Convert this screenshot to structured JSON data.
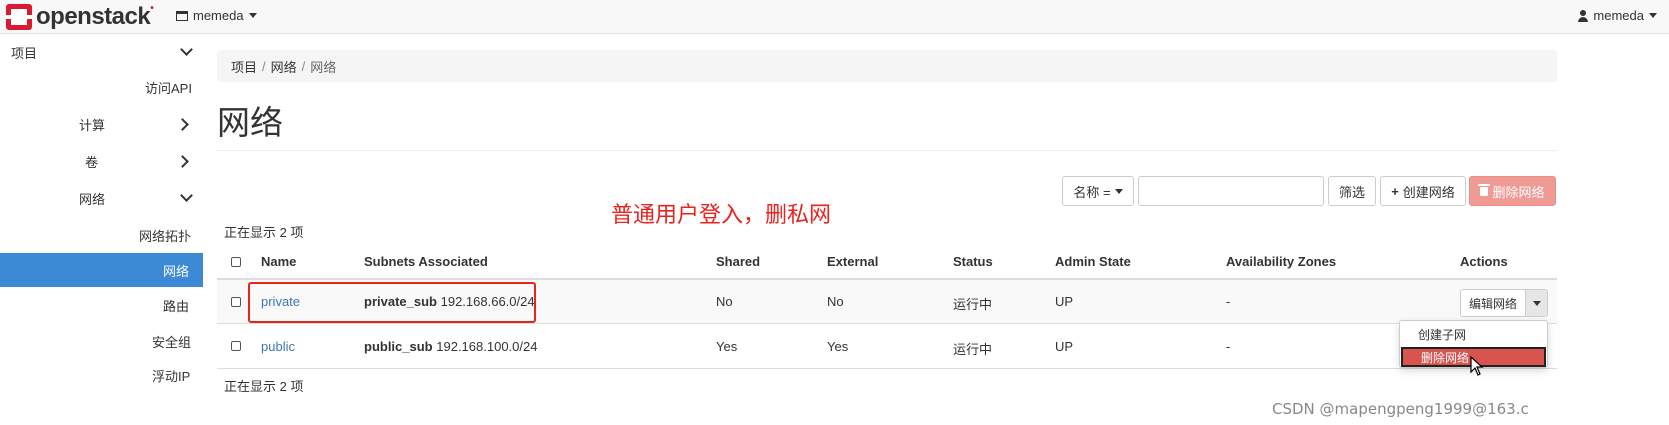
{
  "topbar": {
    "logo_text": "openstack",
    "project_name": "memeda",
    "user_name": "memeda"
  },
  "sidebar": {
    "items": [
      {
        "label": "项目"
      },
      {
        "label": "访问API"
      },
      {
        "label": "计算"
      },
      {
        "label": "卷"
      },
      {
        "label": "网络"
      },
      {
        "label": "网络拓扑"
      },
      {
        "label": "网络"
      },
      {
        "label": "路由"
      },
      {
        "label": "安全组"
      },
      {
        "label": "浮动IP"
      }
    ]
  },
  "breadcrumb": [
    "项目",
    "网络",
    "网络"
  ],
  "breadcrumb_sep": "/",
  "page_title": "网络",
  "annotation": "普通用户登入，删私网",
  "toolbar": {
    "filter_field": "名称 =",
    "filter_value": "",
    "filter_button": "筛选",
    "create_button": "创建网络",
    "delete_button": "删除网络"
  },
  "count_text": "正在显示 2 项",
  "table": {
    "headers": [
      "Name",
      "Subnets Associated",
      "Shared",
      "External",
      "Status",
      "Admin State",
      "Availability Zones",
      "Actions"
    ],
    "rows": [
      {
        "name": "private",
        "subnet_name": "private_sub",
        "subnet_cidr": "192.168.66.0/24",
        "shared": "No",
        "external": "No",
        "status": "运行中",
        "admin_state": "UP",
        "zones": "-",
        "action": "编辑网络"
      },
      {
        "name": "public",
        "subnet_name": "public_sub",
        "subnet_cidr": "192.168.100.0/24",
        "shared": "Yes",
        "external": "Yes",
        "status": "运行中",
        "admin_state": "UP",
        "zones": "-"
      }
    ]
  },
  "actions_menu": [
    "创建子网",
    "删除网络"
  ],
  "watermark": "CSDN @mapengpeng1999@163.c",
  "colors": {
    "accent": "#3c8ad6",
    "brand_red": "#da1a32",
    "danger": "#d9534f",
    "annotation_red": "#e8231d",
    "link": "#3c78b5"
  }
}
